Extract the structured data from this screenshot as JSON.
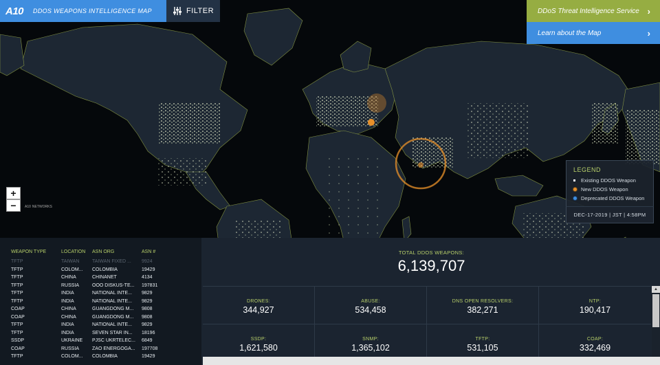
{
  "header": {
    "logo": "A10",
    "title": "DDOS WEAPONS INTELLIGENCE MAP",
    "filter_label": "FILTER"
  },
  "top_right": {
    "service_label": "DDoS Threat Intelligence Service",
    "learn_label": "Learn about the Map"
  },
  "zoom": {
    "in_label": "+",
    "out_label": "−"
  },
  "mini_logo": "A10",
  "mini_logo_sub": "NETWORKS",
  "legend": {
    "title": "LEGEND",
    "items": [
      {
        "label": "Existing DDOS Weapon",
        "color": "#ffffff"
      },
      {
        "label": "New DDOS Weapon",
        "color": "#e8902a"
      },
      {
        "label": "Deprecated DDOS Weapon",
        "color": "#3f8ee0"
      }
    ],
    "timestamp": "DEC-17-2019 | JST | 4:58PM"
  },
  "table": {
    "headers": [
      "WEAPON TYPE",
      "LOCATION",
      "ASN ORG",
      "ASN #"
    ],
    "rows": [
      [
        "TFTP",
        "TAIWAN",
        "TAIWAN FIXED ...",
        "9924"
      ],
      [
        "TFTP",
        "COLOM...",
        "COLOMBIA",
        "19429"
      ],
      [
        "TFTP",
        "CHINA",
        "CHINANET",
        "4134"
      ],
      [
        "TFTP",
        "RUSSIA",
        "OOO DISKUS-TE...",
        "197831"
      ],
      [
        "TFTP",
        "INDIA",
        "NATIONAL INTE...",
        "9829"
      ],
      [
        "TFTP",
        "INDIA",
        "NATIONAL INTE...",
        "9829"
      ],
      [
        "COAP",
        "CHINA",
        "GUANGDONG M...",
        "9808"
      ],
      [
        "COAP",
        "CHINA",
        "GUANGDONG M...",
        "9808"
      ],
      [
        "TFTP",
        "INDIA",
        "NATIONAL INTE...",
        "9829"
      ],
      [
        "TFTP",
        "INDIA",
        "SEVEN STAR IN...",
        "18196"
      ],
      [
        "SSDP",
        "UKRAINE",
        "PJSC UKRTELEC...",
        "6849"
      ],
      [
        "COAP",
        "RUSSIA",
        "ZAO ENERGOGA...",
        "197708"
      ],
      [
        "TFTP",
        "COLOM...",
        "COLOMBIA",
        "19429"
      ]
    ]
  },
  "stats": {
    "total_label": "TOTAL DDOS WEAPONS:",
    "total_value": "6,139,707",
    "cells": [
      {
        "label": "DRONES:",
        "value": "344,927"
      },
      {
        "label": "ABUSE:",
        "value": "534,458"
      },
      {
        "label": "DNS OPEN RESOLVERS:",
        "value": "382,271"
      },
      {
        "label": "NTP:",
        "value": "190,417"
      },
      {
        "label": "SSDP:",
        "value": "1,621,580"
      },
      {
        "label": "SNMP:",
        "value": "1,365,102"
      },
      {
        "label": "TFTP:",
        "value": "531,105"
      },
      {
        "label": "COAP:",
        "value": "332,469"
      }
    ]
  }
}
